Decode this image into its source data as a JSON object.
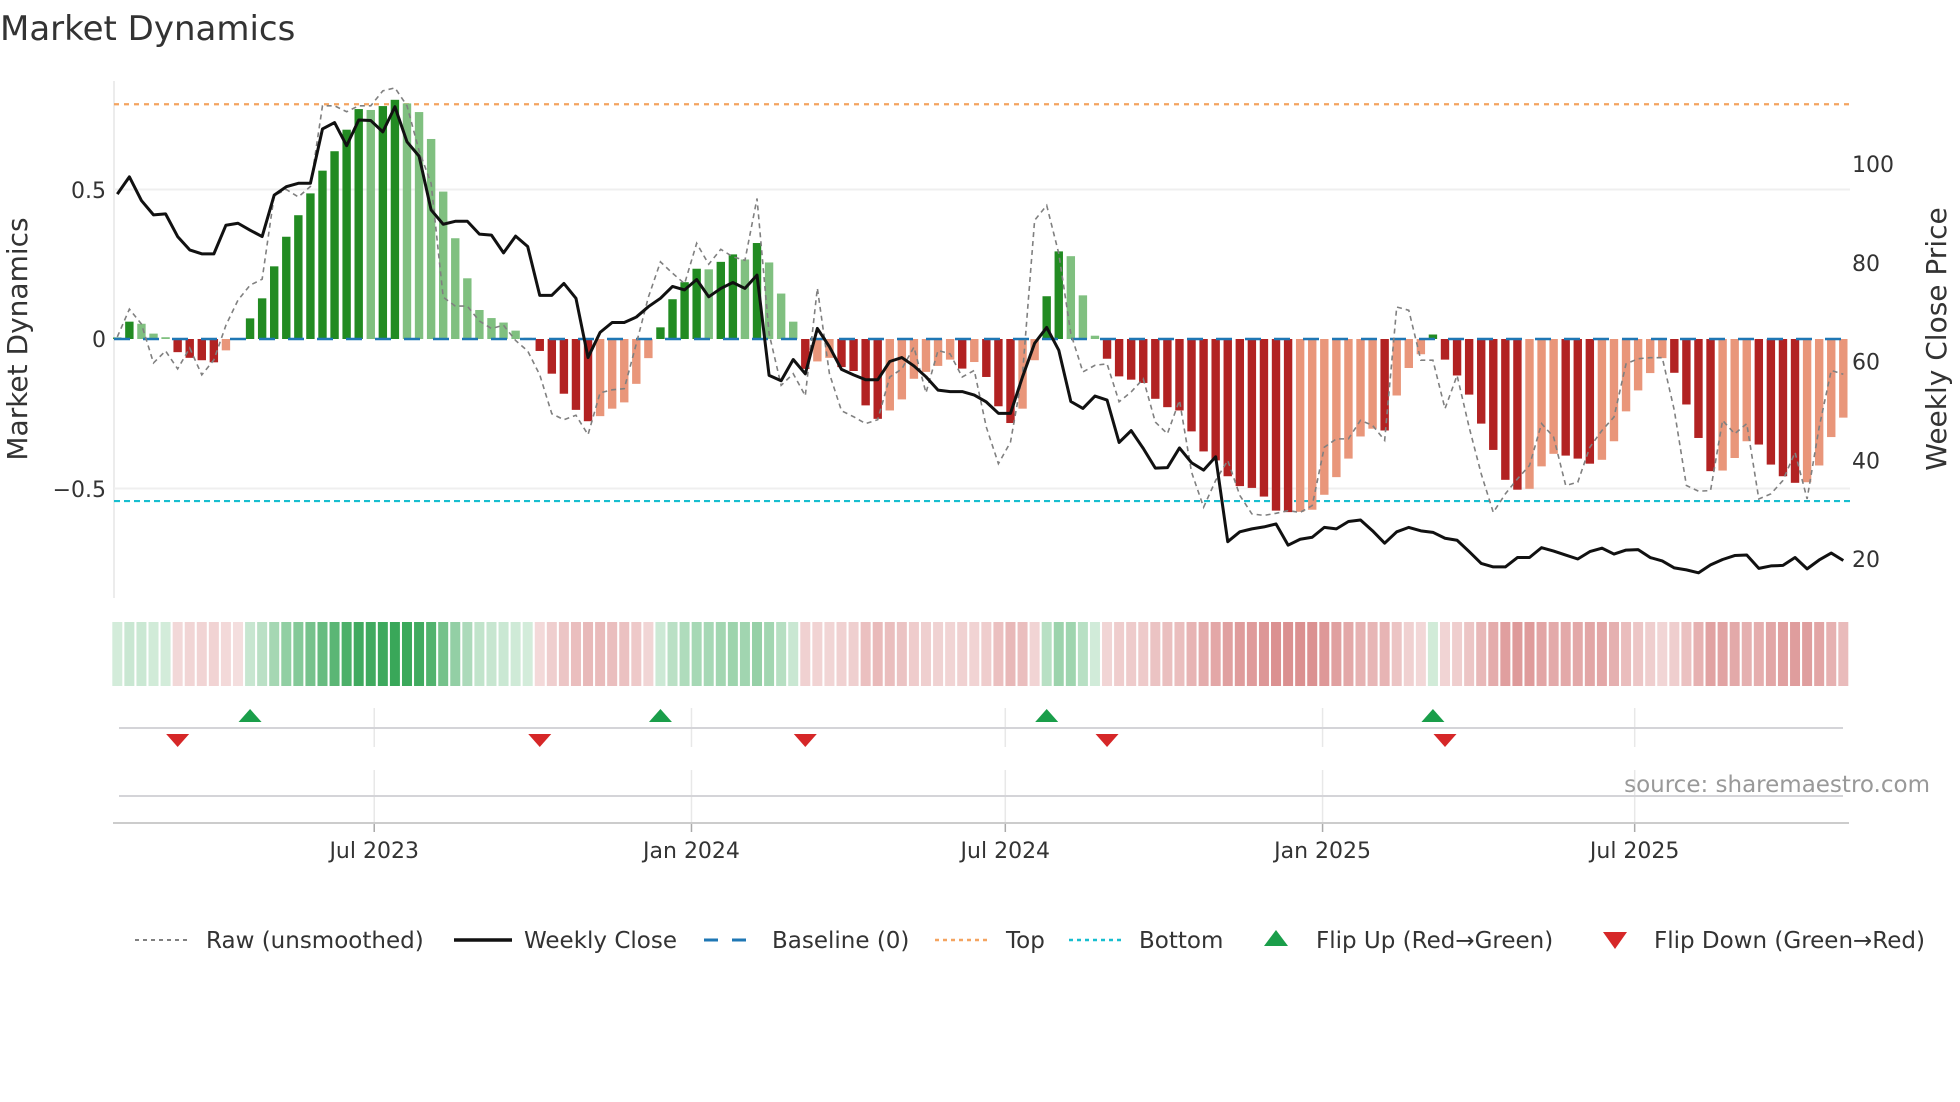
{
  "chart_data": {
    "type": "bar",
    "title": "Market Dynamics",
    "ylabel": "Market Dynamics",
    "ylabel_right": "Weekly Close Price",
    "ylim": [
      -0.863,
      0.863
    ],
    "ylim_right": [
      12.1,
      116.8
    ],
    "yticks": [
      {
        "value": 0.5,
        "label": "0.5"
      },
      {
        "value": 0,
        "label": "0"
      },
      {
        "value": -0.5,
        "label": "−0.5"
      }
    ],
    "yticks_right": [
      {
        "value": 100,
        "label": "100"
      },
      {
        "value": 80,
        "label": "80"
      },
      {
        "value": 60,
        "label": "60"
      },
      {
        "value": 40,
        "label": "40"
      },
      {
        "value": 20,
        "label": "20"
      }
    ],
    "x_start_date": "2023-02-02",
    "x_frequency": "weekly",
    "xticks": [
      {
        "date": "2023-07-01",
        "label": "Jul 2023"
      },
      {
        "date": "2024-01-01",
        "label": "Jan 2024"
      },
      {
        "date": "2024-07-01",
        "label": "Jul 2024"
      },
      {
        "date": "2025-01-01",
        "label": "Jan 2025"
      },
      {
        "date": "2025-07-01",
        "label": "Jul 2025"
      }
    ],
    "top_level": 0.785,
    "bottom_level": -0.542,
    "baseline": 0,
    "series": [
      {
        "name": "Market Dynamics (smoothed)",
        "values": [
          0.005,
          0.058,
          0.051,
          0.018,
          0.006,
          -0.044,
          -0.063,
          -0.071,
          -0.078,
          -0.038,
          -0.002,
          0.069,
          0.136,
          0.243,
          0.342,
          0.414,
          0.487,
          0.563,
          0.628,
          0.7,
          0.769,
          0.766,
          0.779,
          0.8,
          0.788,
          0.759,
          0.669,
          0.493,
          0.337,
          0.203,
          0.097,
          0.07,
          0.055,
          0.028,
          0.004,
          -0.04,
          -0.116,
          -0.183,
          -0.237,
          -0.275,
          -0.258,
          -0.233,
          -0.212,
          -0.15,
          -0.064,
          0.039,
          0.133,
          0.19,
          0.235,
          0.233,
          0.258,
          0.283,
          0.266,
          0.321,
          0.256,
          0.152,
          0.058,
          -0.1,
          -0.075,
          -0.063,
          -0.094,
          -0.107,
          -0.222,
          -0.267,
          -0.239,
          -0.202,
          -0.133,
          -0.11,
          -0.09,
          -0.069,
          -0.099,
          -0.077,
          -0.127,
          -0.225,
          -0.281,
          -0.233,
          -0.071,
          0.143,
          0.293,
          0.277,
          0.146,
          0.011,
          -0.066,
          -0.125,
          -0.136,
          -0.147,
          -0.2,
          -0.228,
          -0.239,
          -0.309,
          -0.376,
          -0.406,
          -0.459,
          -0.492,
          -0.498,
          -0.527,
          -0.574,
          -0.579,
          -0.578,
          -0.571,
          -0.521,
          -0.462,
          -0.4,
          -0.326,
          -0.3,
          -0.306,
          -0.189,
          -0.097,
          -0.051,
          0.015,
          -0.069,
          -0.122,
          -0.186,
          -0.283,
          -0.371,
          -0.471,
          -0.504,
          -0.501,
          -0.426,
          -0.384,
          -0.39,
          -0.4,
          -0.417,
          -0.404,
          -0.342,
          -0.242,
          -0.172,
          -0.114,
          -0.064,
          -0.113,
          -0.219,
          -0.331,
          -0.442,
          -0.44,
          -0.398,
          -0.342,
          -0.353,
          -0.42,
          -0.459,
          -0.481,
          -0.479,
          -0.423,
          -0.328,
          -0.263
        ]
      },
      {
        "name": "Raw (unsmoothed)",
        "values": [
          0.007,
          0.1,
          0.05,
          -0.08,
          -0.04,
          -0.1,
          -0.03,
          -0.12,
          -0.07,
          0.046,
          0.13,
          0.18,
          0.2,
          0.48,
          0.5,
          0.475,
          0.51,
          0.78,
          0.78,
          0.76,
          0.78,
          0.78,
          0.83,
          0.84,
          0.78,
          0.63,
          0.52,
          0.14,
          0.11,
          0.11,
          0.06,
          0.035,
          0.046,
          -0.005,
          -0.04,
          -0.12,
          -0.25,
          -0.27,
          -0.255,
          -0.32,
          -0.18,
          -0.17,
          -0.166,
          -0.016,
          0.14,
          0.258,
          0.22,
          0.185,
          0.32,
          0.25,
          0.3,
          0.275,
          0.263,
          0.47,
          0.018,
          -0.155,
          -0.116,
          -0.19,
          0.17,
          -0.116,
          -0.24,
          -0.26,
          -0.283,
          -0.27,
          -0.127,
          -0.1,
          -0.027,
          -0.18,
          -0.038,
          -0.05,
          -0.127,
          -0.105,
          -0.295,
          -0.417,
          -0.345,
          -0.116,
          0.397,
          0.447,
          0.286,
          0.018,
          -0.11,
          -0.088,
          -0.083,
          -0.21,
          -0.177,
          -0.133,
          -0.278,
          -0.317,
          -0.205,
          -0.445,
          -0.5625,
          -0.473,
          -0.406,
          -0.523,
          -0.585,
          -0.59,
          -0.583,
          -0.574,
          -0.58,
          -0.557,
          -0.362,
          -0.334,
          -0.334,
          -0.272,
          -0.289,
          -0.339,
          0.107,
          0.096,
          -0.071,
          -0.071,
          -0.233,
          -0.122,
          -0.295,
          -0.451,
          -0.58,
          -0.518,
          -0.468,
          -0.423,
          -0.283,
          -0.328,
          -0.49,
          -0.479,
          -0.362,
          -0.306,
          -0.261,
          -0.083,
          -0.066,
          -0.0625,
          -0.0625,
          -0.239,
          -0.49,
          -0.509,
          -0.507,
          -0.272,
          -0.317,
          -0.283,
          -0.535,
          -0.518,
          -0.473,
          -0.379,
          -0.535,
          -0.295,
          -0.105,
          -0.118
        ]
      },
      {
        "name": "Weekly Close",
        "axis": "right",
        "values": [
          93.9,
          97.4,
          92.6,
          89.7,
          89.9,
          85.3,
          82.6,
          81.8,
          81.8,
          87.6,
          88.0,
          86.6,
          85.3,
          93.7,
          95.4,
          96.1,
          96.1,
          107.1,
          108.4,
          103.7,
          108.9,
          108.8,
          106.5,
          111.6,
          104.5,
          101.6,
          90.7,
          87.8,
          88.4,
          88.4,
          85.8,
          85.6,
          82.0,
          85.4,
          83.3,
          73.4,
          73.4,
          75.8,
          72.8,
          60.8,
          65.9,
          67.9,
          67.9,
          69.0,
          71.1,
          72.8,
          75.2,
          74.5,
          76.6,
          73.1,
          74.8,
          76.0,
          74.8,
          77.5,
          57.2,
          56.1,
          60.4,
          57.5,
          66.7,
          63.0,
          58.4,
          57.3,
          56.3,
          56.3,
          60.0,
          60.8,
          59.1,
          56.9,
          54.2,
          53.9,
          53.9,
          53.2,
          51.8,
          49.5,
          49.5,
          56.9,
          63.7,
          66.9,
          62.3,
          51.9,
          50.5,
          53.0,
          52.2,
          43.6,
          46.0,
          42.4,
          38.4,
          38.5,
          42.5,
          39.5,
          38.0,
          40.7,
          23.5,
          25.5,
          26.1,
          26.5,
          27.1,
          22.8,
          24.0,
          24.4,
          26.4,
          26.1,
          27.6,
          27.9,
          25.7,
          23.2,
          25.5,
          26.4,
          25.7,
          25.4,
          24.2,
          23.8,
          21.5,
          19.1,
          18.4,
          18.4,
          20.3,
          20.3,
          22.3,
          21.6,
          20.8,
          20.0,
          21.5,
          22.2,
          21.0,
          21.8,
          21.9,
          20.3,
          19.6,
          18.2,
          17.8,
          17.2,
          18.8,
          19.9,
          20.7,
          20.8,
          18.1,
          18.6,
          18.7,
          20.3,
          18.0,
          19.8,
          21.2,
          19.7
        ]
      }
    ],
    "legend": {
      "placement": "bottom",
      "items": [
        {
          "label": "Raw (unsmoothed)",
          "kind": "raw"
        },
        {
          "label": "Weekly Close",
          "kind": "close"
        },
        {
          "label": "Baseline (0)",
          "kind": "baseline"
        },
        {
          "label": "Top",
          "kind": "top"
        },
        {
          "label": "Bottom",
          "kind": "bottom"
        },
        {
          "label": "Flip Up (Red→Green)",
          "kind": "flipup"
        },
        {
          "label": "Flip Down (Green→Red)",
          "kind": "flipdown"
        }
      ]
    },
    "source": "source: sharemaestro.com",
    "colors": {
      "up_strong": "#228b22",
      "up_weak": "#80c080",
      "down_strong": "#b22222",
      "down_weak": "#e9967a",
      "raw": "#808080",
      "close": "#111111",
      "baseline": "#1f77b4",
      "top": "#f4a460",
      "bottom": "#17becf",
      "flip_up": "#1a9e4a",
      "flip_down": "#d62728"
    }
  }
}
